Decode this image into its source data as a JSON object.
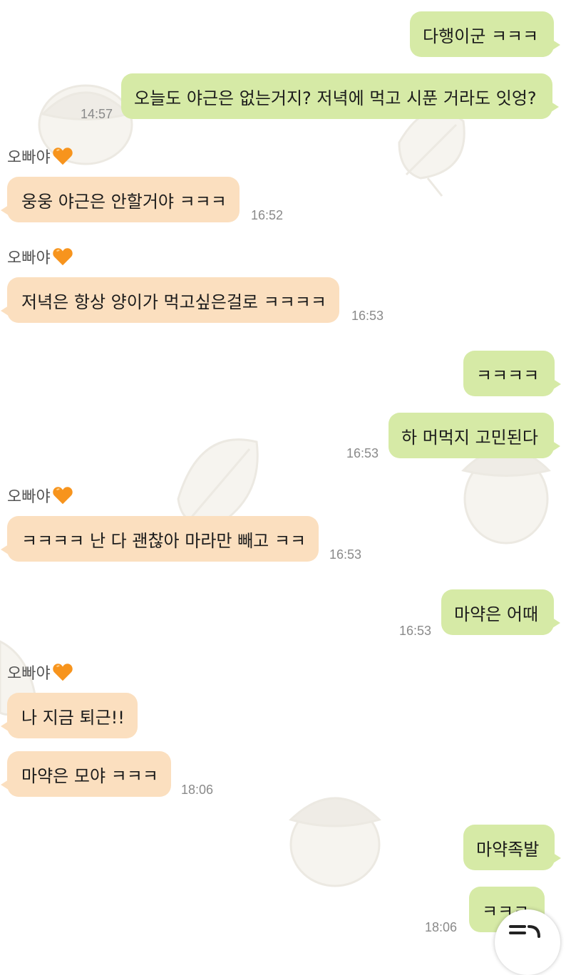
{
  "conversation": {
    "messages": [
      {
        "side": "me",
        "text": "다행이군 ㅋㅋㅋ"
      },
      {
        "side": "me",
        "text": "오늘도 야근은 없는거지? 저녁에 먹고 시푼 거라도 잇엉?",
        "time": "14:57"
      },
      {
        "side": "them",
        "sender": "오빠야",
        "text": "웅웅 야근은 안할거야 ㅋㅋㅋ",
        "time": "16:52"
      },
      {
        "side": "them",
        "sender": "오빠야",
        "text": "저녁은 항상 양이가 먹고싶은걸로 ㅋㅋㅋㅋ",
        "time": "16:53"
      },
      {
        "side": "me",
        "text": "ㅋㅋㅋㅋ"
      },
      {
        "side": "me",
        "text": "하 머먹지 고민된다",
        "time": "16:53"
      },
      {
        "side": "them",
        "sender": "오빠야",
        "text": "ㅋㅋㅋㅋ 난 다 괜찮아 마라만 빼고 ㅋㅋ",
        "time": "16:53"
      },
      {
        "side": "me",
        "text": "마약은 어때",
        "time": "16:53"
      },
      {
        "side": "them",
        "sender": "오빠야",
        "text": "나 지금 퇴근!!"
      },
      {
        "side": "them",
        "text": "마약은 모야 ㅋㅋㅋ",
        "time": "18:06"
      },
      {
        "side": "me",
        "text": "마약족발"
      },
      {
        "side": "me",
        "text": "ㅋㅋㅋ",
        "time": "18:06"
      }
    ]
  },
  "icons": {
    "sender_badge": "orange-heart-icon",
    "scroll_button": "scroll-down-icon"
  },
  "colors": {
    "my_bubble": "#d6eaa6",
    "their_bubble": "#fbdfbf",
    "timestamp": "#8a8a8a",
    "heart": "#f7941d"
  }
}
